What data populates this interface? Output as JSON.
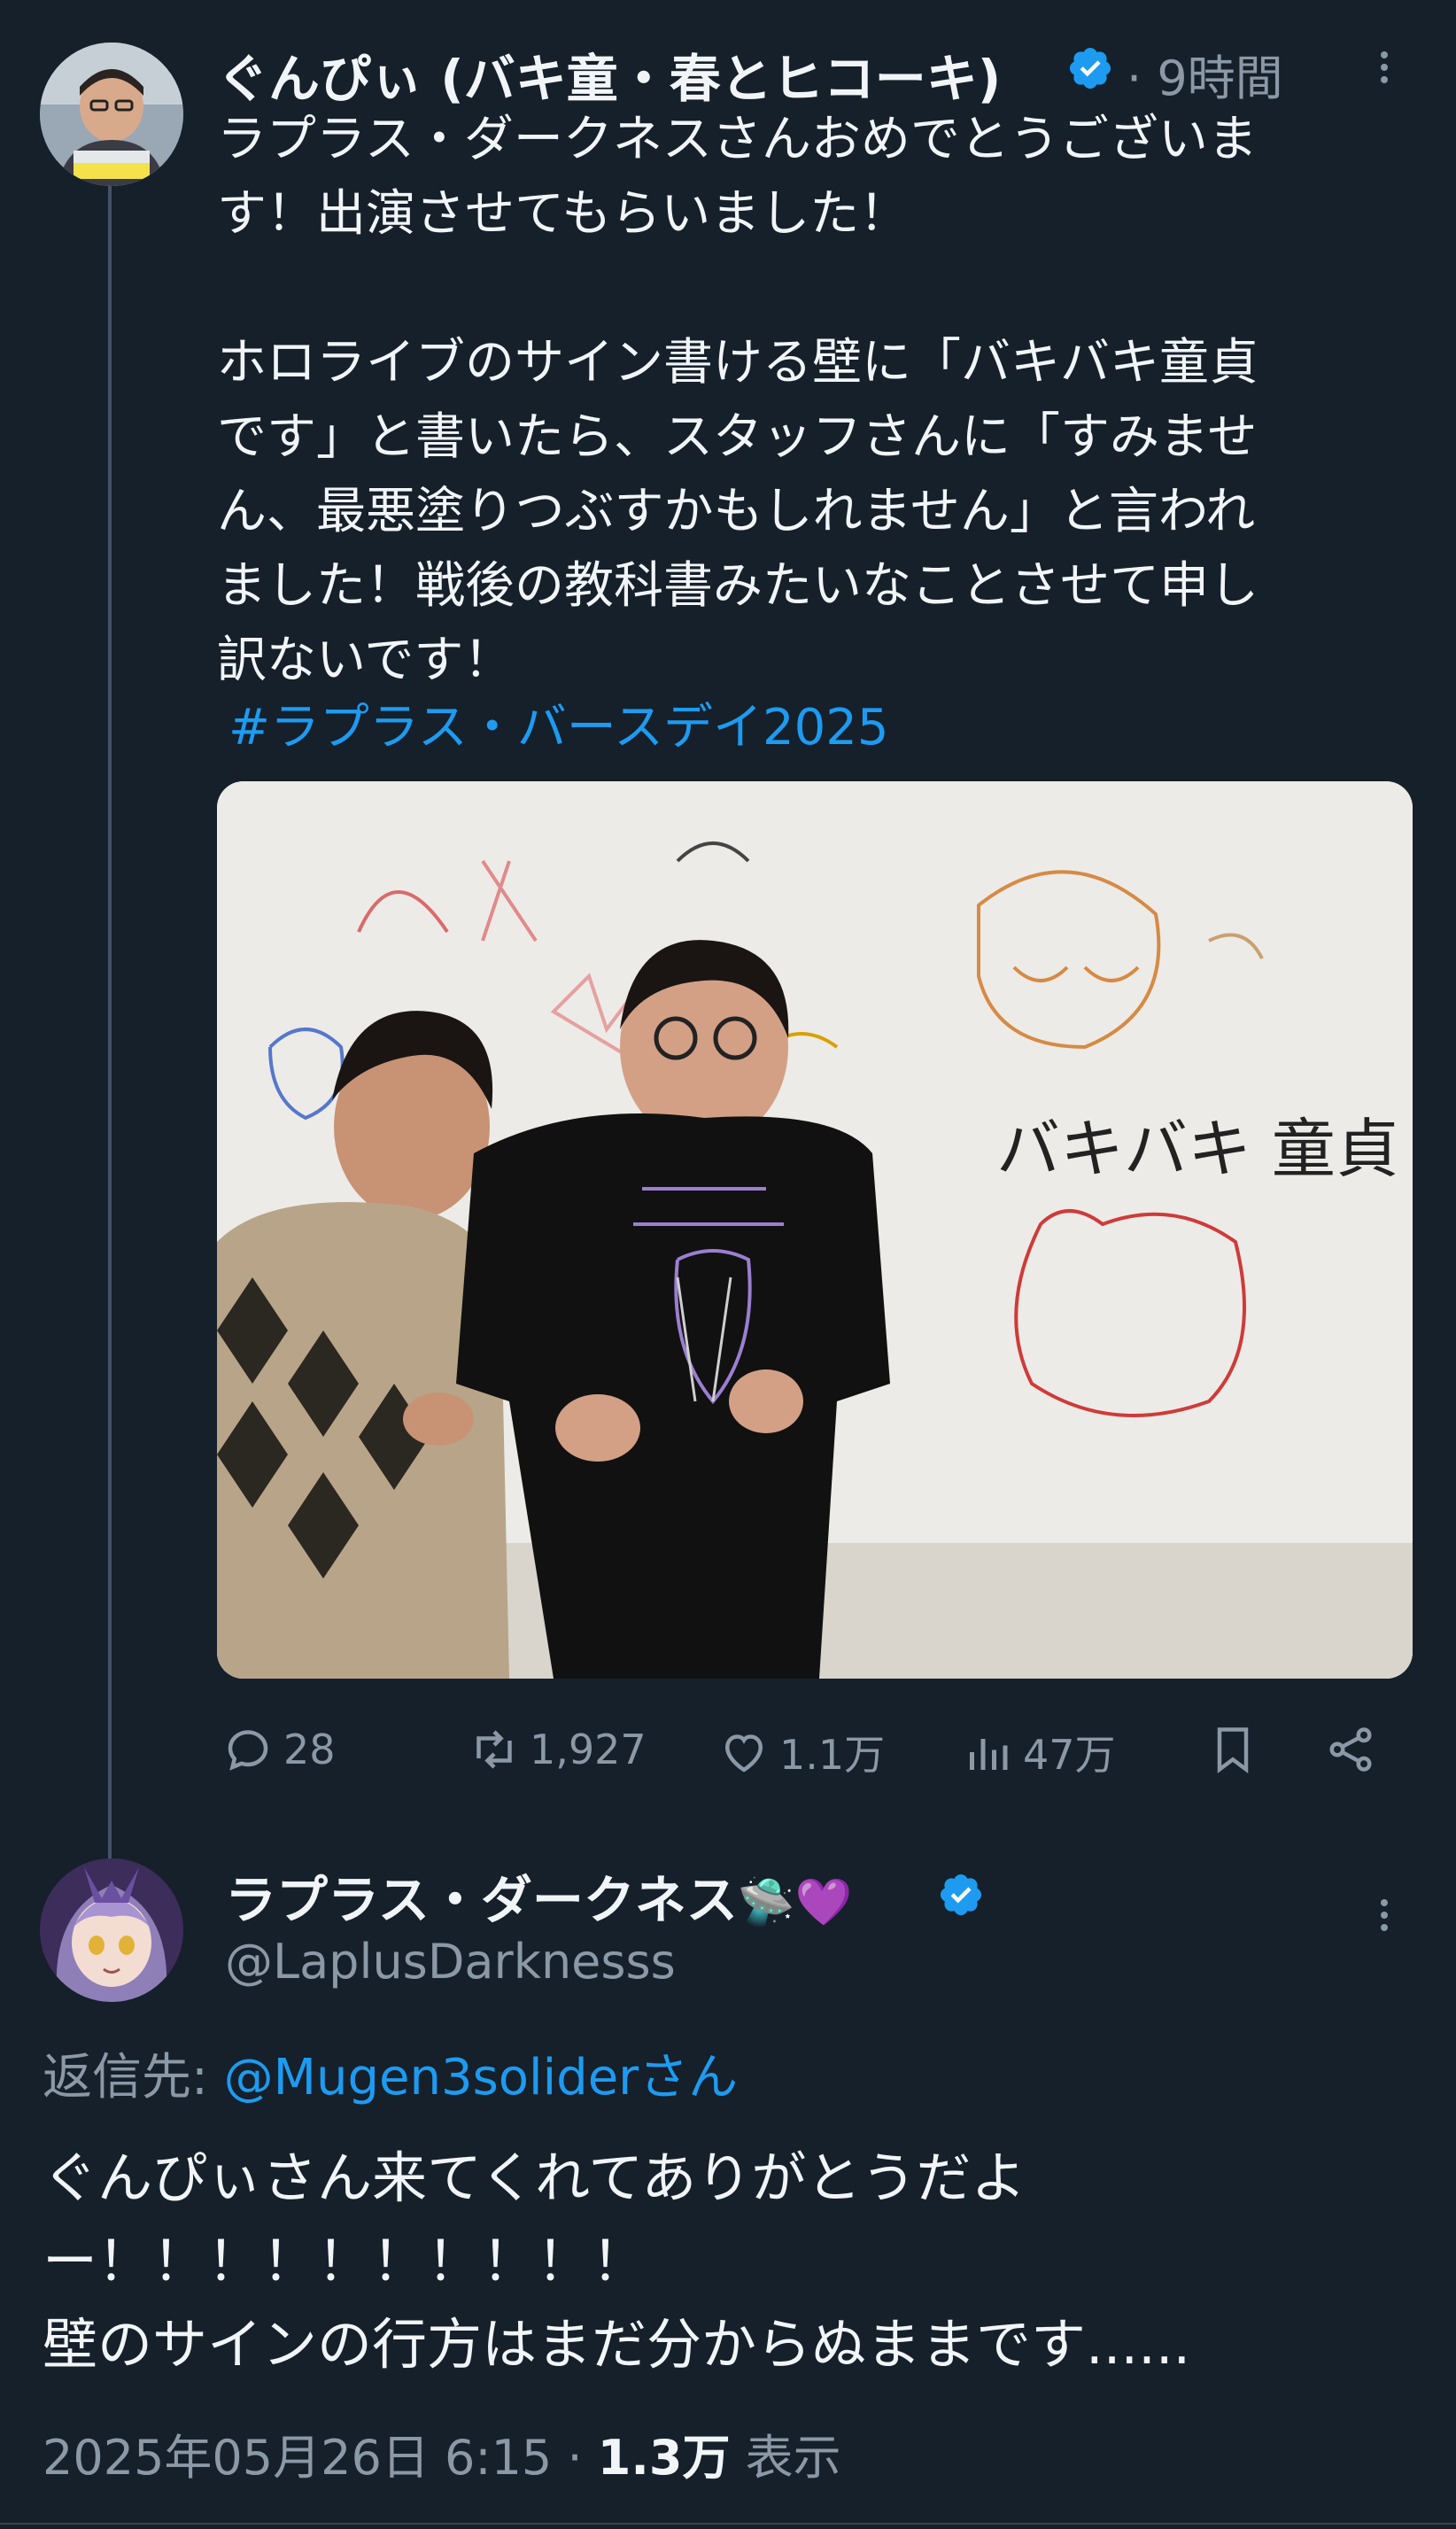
{
  "tweet1": {
    "display_name": "ぐんぴぃ (バキ童・春とヒコーキ)",
    "time": "· 9時間",
    "text": "ラプラス・ダークネスさんおめでとうございま\nす！出演させてもらいました！\n\nホロライブのサイン書ける壁に「バキバキ童貞\nです」と書いたら、スタッフさんに「すみませ\nん、最悪塗りつぶすかもしれません」と言われ\nました！戦後の教科書みたいなことさせて申し\n訳ないです！",
    "hashtag": "#ラプラス・バースデイ2025",
    "photo_text": "バキバキ 童貞 です!!",
    "actions": {
      "replies": "28",
      "retweets": "1,927",
      "likes": "1.1万",
      "views": "47万"
    }
  },
  "tweet2": {
    "display_name": "ラプラス・ダークネス",
    "name_emoji": "🛸💜",
    "handle": "@LaplusDarknesss",
    "reply_prefix": "返信先: ",
    "reply_to": "@Mugen3soliderさん",
    "text": "ぐんぴぃさん来てくれてありがとうだよ\nー！！！！！！！！！！\n壁のサインの行方はまだ分からぬままです......",
    "timestamp": "2025年05月26日 6:15 · ",
    "view_count": "1.3万",
    "view_label": " 表示"
  },
  "colors": {
    "background": "#15202b",
    "text": "#f2f5f7",
    "muted": "#8b98a5",
    "link": "#1d9bf0",
    "verified": "#1d9bf0"
  },
  "icons": [
    "verified-badge-icon",
    "more-icon",
    "reply-icon",
    "retweet-icon",
    "like-icon",
    "views-icon",
    "bookmark-icon",
    "share-icon"
  ]
}
